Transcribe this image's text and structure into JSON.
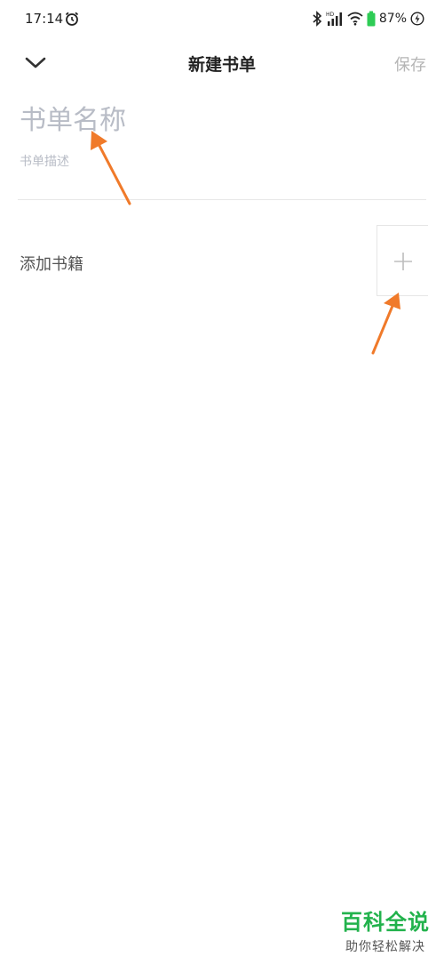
{
  "status_bar": {
    "time": "17:14",
    "battery": "87%",
    "icons": [
      "alarm-icon",
      "bluetooth-icon",
      "hd-signal-icon",
      "wifi-icon",
      "battery-icon",
      "charging-icon"
    ]
  },
  "nav": {
    "title": "新建书单",
    "save_label": "保存",
    "back_icon": "chevron-down-icon"
  },
  "form": {
    "name_placeholder": "书单名称",
    "name_value": "",
    "description_placeholder": "书单描述",
    "description_value": ""
  },
  "add_books": {
    "label": "添加书籍",
    "icon": "plus-icon"
  },
  "annotations": {
    "arrow_color": "#f07a2a",
    "count": 2
  },
  "watermark": {
    "title": "百科全说",
    "subtitle": "助你轻松解决"
  },
  "colors": {
    "save_disabled": "#b5b5b5",
    "placeholder": "#b8bcc6",
    "watermark_green": "#22b24c",
    "battery_green": "#2ecc55"
  }
}
